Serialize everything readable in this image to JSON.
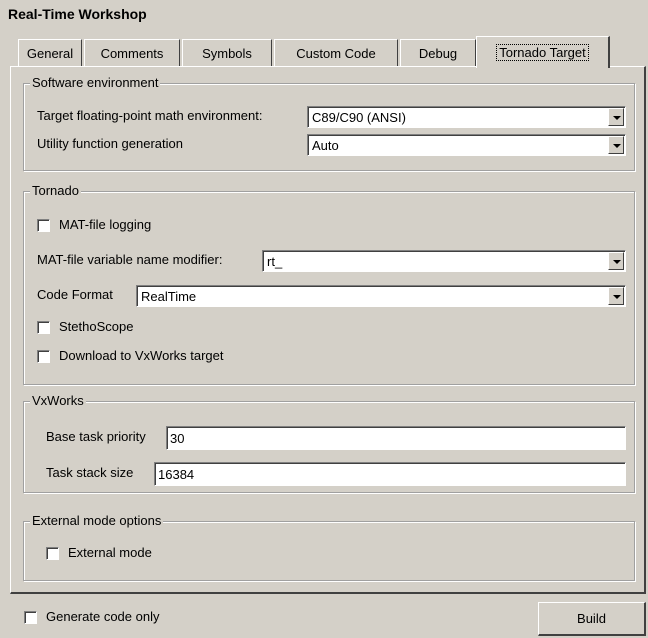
{
  "window": {
    "title": "Real-Time Workshop"
  },
  "tabs": [
    {
      "label": "General"
    },
    {
      "label": "Comments"
    },
    {
      "label": "Symbols"
    },
    {
      "label": "Custom Code"
    },
    {
      "label": "Debug"
    },
    {
      "label": "Tornado Target",
      "active": true
    }
  ],
  "software_env": {
    "legend": "Software environment",
    "math_label": "Target floating-point math environment:",
    "math_value": "C89/C90 (ANSI)",
    "util_label": "Utility function generation",
    "util_value": "Auto"
  },
  "tornado": {
    "legend": "Tornado",
    "mat_logging": {
      "label": "MAT-file logging",
      "checked": false
    },
    "mat_modifier_label": "MAT-file variable name modifier:",
    "mat_modifier_value": "rt_",
    "code_format_label": "Code Format",
    "code_format_value": "RealTime",
    "stethoscope": {
      "label": "StethoScope",
      "checked": false
    },
    "download": {
      "label": "Download to VxWorks target",
      "checked": false
    }
  },
  "vxworks": {
    "legend": "VxWorks",
    "priority_label": "Base task priority",
    "priority_value": "30",
    "stack_label": "Task stack size",
    "stack_value": "16384"
  },
  "external": {
    "legend": "External mode options",
    "external_mode": {
      "label": "External mode",
      "checked": false
    }
  },
  "footer": {
    "generate_only": {
      "label": "Generate code only",
      "checked": false
    },
    "build_label": "Build"
  }
}
